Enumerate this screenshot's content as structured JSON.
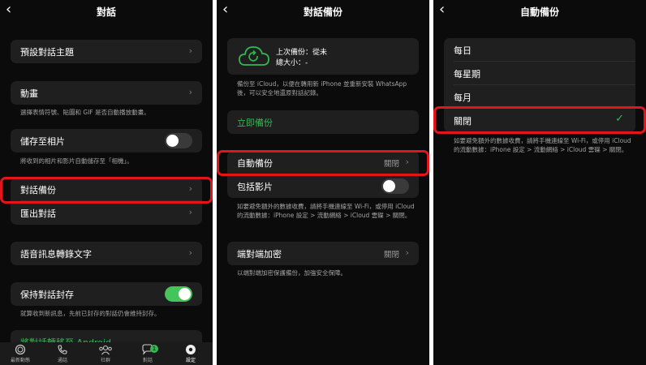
{
  "panel1": {
    "title": "對話",
    "rows": {
      "theme": "預設對話主題",
      "animation": "動畫",
      "save_photos": "儲存至相片",
      "backup": "對話備份",
      "export": "匯出對話",
      "transcribe": "語音訊息轉錄文字",
      "keep_archived": "保持對話封存",
      "android": "將對話轉移至 Android"
    },
    "captions": {
      "animation": "選擇表情符號、貼圖和 GIF 是否自動播放動畫。",
      "save_photos": "將收到的相片和影片自動儲存至「相機」。",
      "keep_archived": "就算收到新訊息，先前已封存的對話仍會維持封存。"
    },
    "toggles": {
      "save_photos": false,
      "keep_archived": true
    },
    "tabs": [
      "最新動態",
      "通話",
      "社群",
      "對話",
      "設定"
    ],
    "badge": "1",
    "colors": {
      "accent": "#35b852",
      "highlight": "#e3141a"
    }
  },
  "panel2": {
    "title": "對話備份",
    "last_backup": "上次備份：從未",
    "total_size": "總大小：-",
    "caption_icloud": "備份至 iCloud，以便在轉用新 iPhone 並重新安裝 WhatsApp 後，可以安全地還原對話記錄。",
    "backup_now": "立即備份",
    "auto_backup": "自動備份",
    "auto_backup_value": "關閉",
    "include_videos": "包括影片",
    "include_videos_on": false,
    "caption_data": "如要避免額外的數據收費，請將手機連線至 Wi-Fi，或停用 iCloud 的流動數據：iPhone 設定 > 流動網絡 > iCloud 雲碟 > 關閉。",
    "e2e": "端對端加密",
    "e2e_value": "關閉",
    "caption_e2e": "以端對端加密保護備份，加強安全保障。"
  },
  "panel3": {
    "title": "自動備份",
    "options": [
      "每日",
      "每星期",
      "每月",
      "關閉"
    ],
    "selected": "關閉",
    "caption": "如要避免額外的數據收費，請將手機連線至 Wi-Fi，或停用 iCloud 的流動數據：iPhone 設定 > 流動網絡 > iCloud 雲碟 > 關閉。"
  }
}
